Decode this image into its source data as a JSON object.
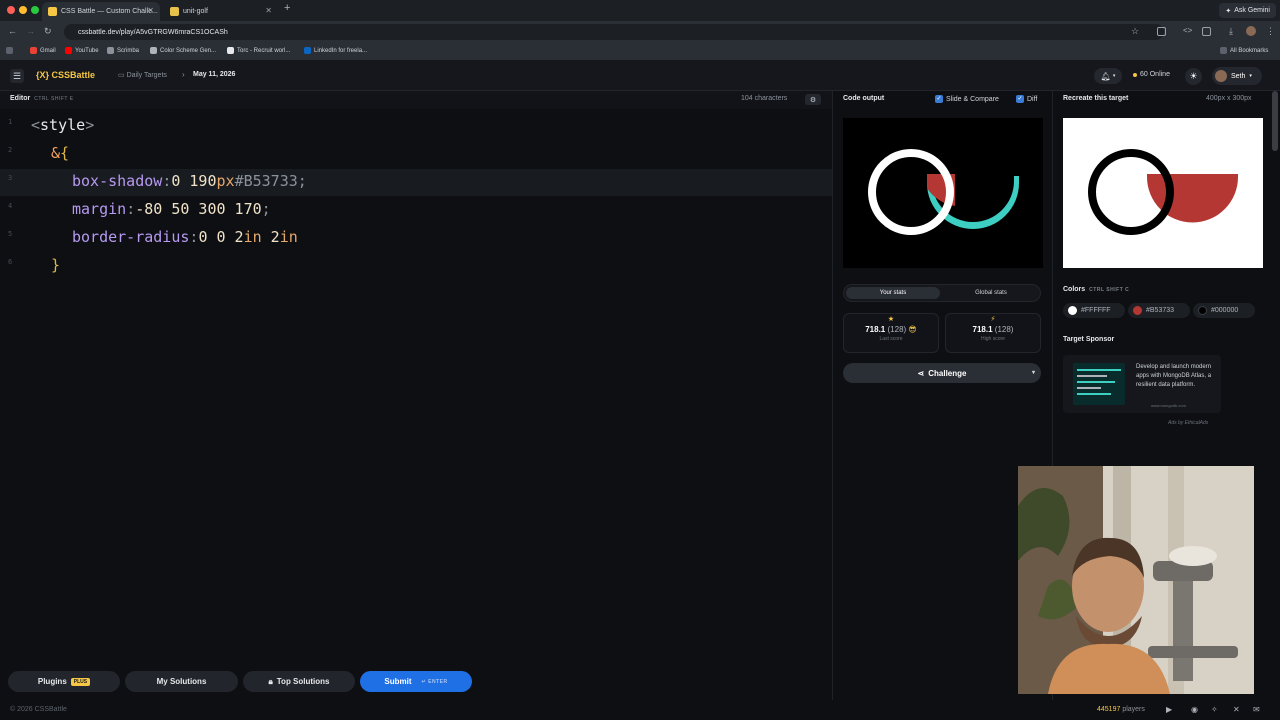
{
  "browser": {
    "tabs": [
      {
        "label": "CSS Battle — Custom Challe..."
      },
      {
        "label": "unit-golf"
      }
    ],
    "ask_label": "Ask Gemini",
    "url": "cssbattle.dev/play/A5vGTRGW6mraCS1OCASh",
    "bookmarks": [
      "Gmail",
      "YouTube",
      "Scrimba",
      "Color Scheme Gen...",
      "Torc - Recruit worl...",
      "LinkedIn for freela..."
    ],
    "all_bookmarks": "All Bookmarks"
  },
  "header": {
    "logo": "{X} CSSBattle",
    "crumb_section": "Daily Targets",
    "crumb_date": "May 11, 2026",
    "online": "60 Online",
    "user": "Seth"
  },
  "editor": {
    "label": "Editor",
    "shortcut": "CTRL SHIFT E",
    "char_count": "104 characters",
    "lines": [
      {
        "n": "1",
        "parts": [
          [
            "punc",
            "<"
          ],
          [
            "tag",
            "style"
          ],
          [
            "punc",
            ">"
          ]
        ]
      },
      {
        "n": "2",
        "parts": [
          [
            "amp",
            "&"
          ],
          [
            "brace",
            "{"
          ]
        ]
      },
      {
        "n": "3",
        "parts": [
          [
            "prop",
            "box-shadow"
          ],
          [
            "punc",
            ":"
          ],
          [
            "val",
            "0 190"
          ],
          [
            "unit",
            "px"
          ],
          [
            "hash",
            "#B53733;"
          ]
        ]
      },
      {
        "n": "4",
        "parts": [
          [
            "prop",
            "margin"
          ],
          [
            "punc",
            ":"
          ],
          [
            "val",
            "-80 50 300 170"
          ],
          [
            "punc",
            ";"
          ]
        ]
      },
      {
        "n": "5",
        "parts": [
          [
            "prop",
            "border-radius"
          ],
          [
            "punc",
            ":"
          ],
          [
            "val",
            "0 0 2"
          ],
          [
            "unit",
            "in"
          ],
          [
            "val",
            " 2"
          ],
          [
            "unit",
            "in"
          ]
        ]
      },
      {
        "n": "6",
        "parts": [
          [
            "brace",
            "}"
          ]
        ]
      }
    ]
  },
  "bottom": {
    "plugins": "Plugins",
    "plus_badge": "PLUS",
    "my_solutions": "My Solutions",
    "top_solutions": "Top Solutions",
    "submit": "Submit",
    "enter_hint": "ENTER",
    "copyright": "© 2026 CSSBattle",
    "players_count": "445197",
    "players_label": "players"
  },
  "output": {
    "title": "Code output",
    "slide_compare": "Slide & Compare",
    "diff": "Diff"
  },
  "target": {
    "title": "Recreate this target",
    "dims": "400px x 300px"
  },
  "stats": {
    "your_stats": "Your stats",
    "global_stats": "Global stats",
    "last_score_value": "718.1",
    "last_score_chars": "(128)",
    "last_score_label": "Last score",
    "high_score_value": "718.1",
    "high_score_chars": "(128)",
    "high_score_label": "High score",
    "challenge": "Challenge"
  },
  "colors": {
    "title": "Colors",
    "shortcut": "CTRL SHIFT C",
    "swatches": [
      {
        "hex": "#FFFFFF"
      },
      {
        "hex": "#B53733"
      },
      {
        "hex": "#000000"
      }
    ]
  },
  "sponsor": {
    "title": "Target Sponsor",
    "text": "Develop and launch modern apps with MongoDB Atlas, a resilient data platform.",
    "url": "www.mongodb.com",
    "ads_by": "Ads by EthicalAds"
  },
  "theme": {
    "accent": "#f6c744",
    "submit_blue": "#1f6fe5",
    "red": "#B53733",
    "teal": "#3ccfc2"
  }
}
